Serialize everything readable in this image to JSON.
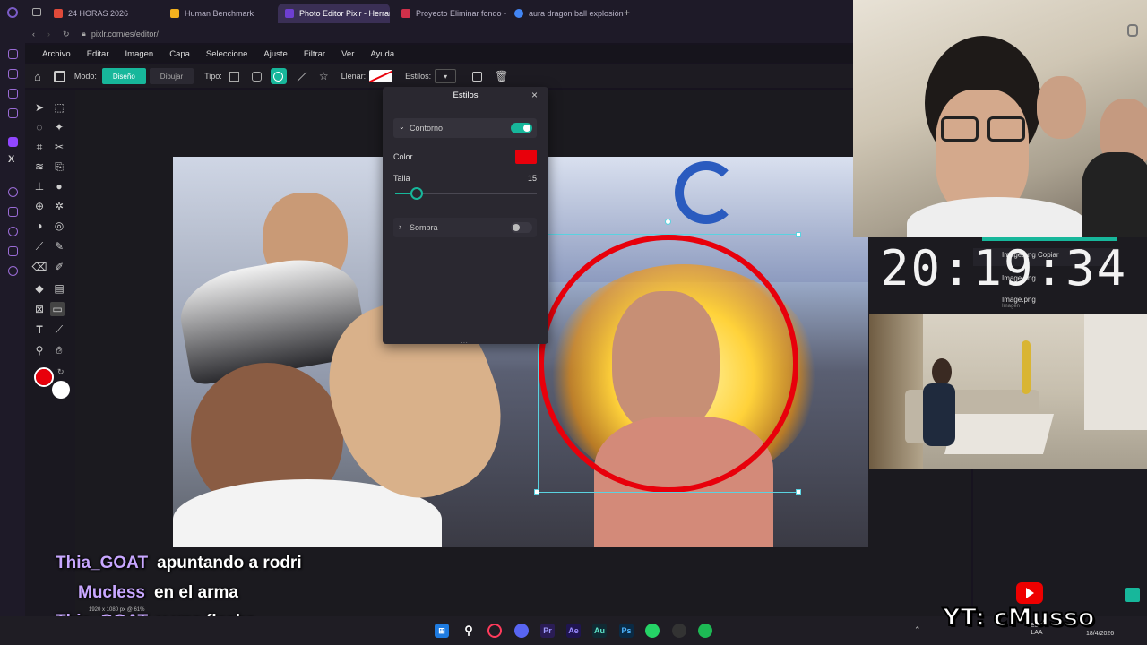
{
  "browser": {
    "tabs": [
      {
        "label": "24 HORAS 2026",
        "color": "#e04a3a"
      },
      {
        "label": "Human Benchmark",
        "color": "#f2b01e"
      },
      {
        "label": "Photo Editor Pixlr - Herran",
        "color": "#6e3fd1"
      },
      {
        "label": "Proyecto Eliminar fondo -",
        "color": "#d0304a"
      },
      {
        "label": "aura dragon ball explosión",
        "color": "#4285f4"
      }
    ],
    "new_tab": "+",
    "url": "pixlr.com/es/editor/"
  },
  "menu": [
    "Archivo",
    "Editar",
    "Imagen",
    "Capa",
    "Seleccione",
    "Ajuste",
    "Filtrar",
    "Ver",
    "Ayuda"
  ],
  "options": {
    "mode_label": "Modo:",
    "mode_design": "Diseño",
    "mode_draw": "Dibujar",
    "type_label": "Tipo:",
    "fill_label": "Llenar:",
    "styles_label": "Estilos:"
  },
  "panel": {
    "title": "Estilos",
    "close": "×",
    "outline_label": "Contorno",
    "color_label": "Color",
    "color_value": "#e8000b",
    "size_label": "Talla",
    "size_value": "15",
    "size_fraction": 0.15,
    "shadow_label": "Sombra",
    "outline_on": true,
    "shadow_on": false,
    "accent": "#17b79b"
  },
  "colors": {
    "foreground": "#e8000b",
    "background": "#ffffff"
  },
  "clock": "20:19:34",
  "layers": [
    {
      "name": "Image.png Copiar",
      "sub": ""
    },
    {
      "name": "Image.png",
      "sub": ""
    },
    {
      "name": "Image.png",
      "sub": "Imagen"
    }
  ],
  "canvas_status": "1920 x 1080 px @ 61%",
  "chat": [
    {
      "user": "Thia_GOAT",
      "message": "apuntando a rodri"
    },
    {
      "user": "Mucless",
      "message": "en el arma"
    },
    {
      "user": "Thia_GOAT",
      "message": "y una flecha"
    }
  ],
  "watermark": "YT: cMusso",
  "tray": {
    "lang": "ESP LAA",
    "date": "18/4/2026"
  }
}
